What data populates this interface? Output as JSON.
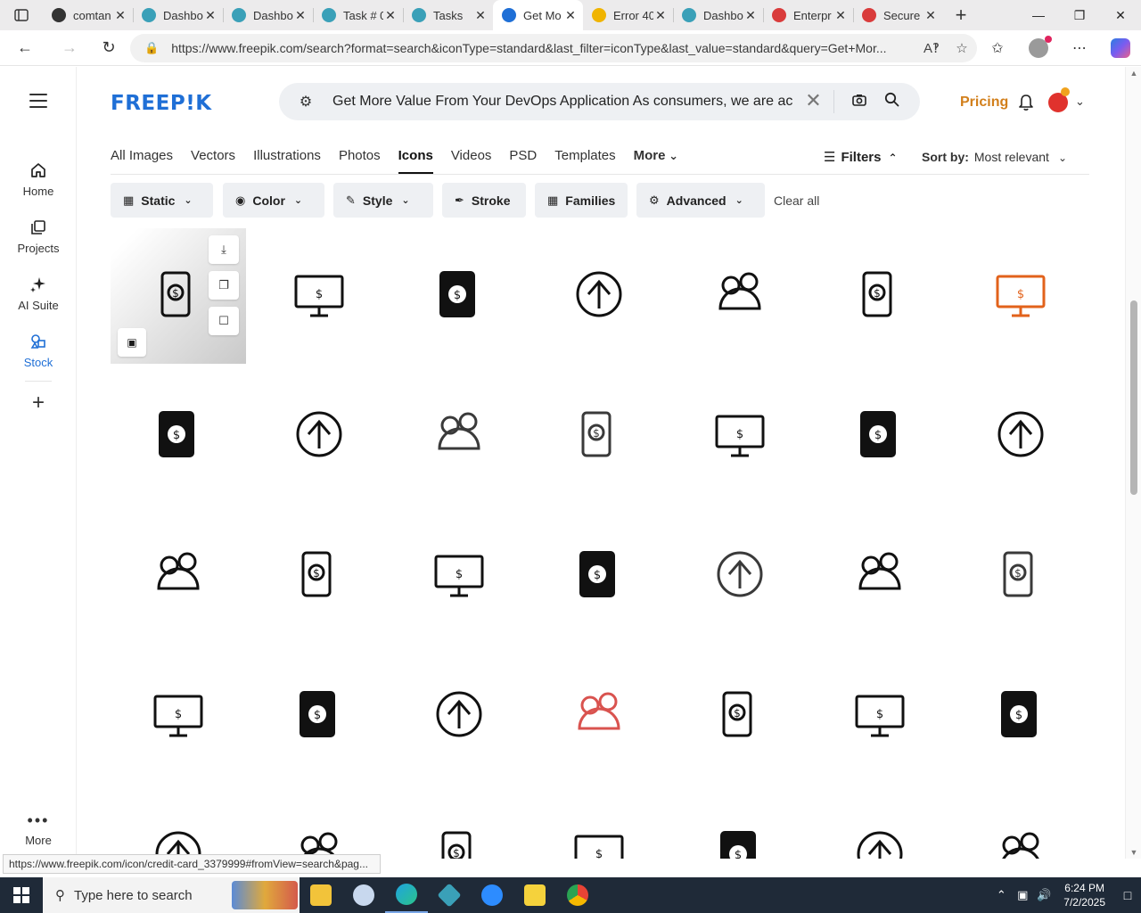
{
  "browser": {
    "tabs": [
      {
        "title": "comtan",
        "color": "#333333",
        "active": false
      },
      {
        "title": "Dashbo",
        "color": "#3aa0b8",
        "active": false
      },
      {
        "title": "Dashbo",
        "color": "#3aa0b8",
        "active": false
      },
      {
        "title": "Task # 0",
        "color": "#3aa0b8",
        "active": false
      },
      {
        "title": "Tasks",
        "color": "#3aa0b8",
        "active": false
      },
      {
        "title": "Get Mo",
        "color": "#1f6fd6",
        "active": true
      },
      {
        "title": "Error 40",
        "color": "#f0b400",
        "active": false
      },
      {
        "title": "Dashbo",
        "color": "#3aa0b8",
        "active": false
      },
      {
        "title": "Enterpr",
        "color": "#d93b3b",
        "active": false
      },
      {
        "title": "Secure",
        "color": "#d93b3b",
        "active": false
      }
    ],
    "url": "https://www.freepik.com/search?format=search&iconType=standard&last_filter=iconType&last_value=standard&query=Get+Mor..."
  },
  "sidebar": {
    "items": [
      {
        "label": "Home"
      },
      {
        "label": "Projects"
      },
      {
        "label": "AI Suite"
      },
      {
        "label": "Stock"
      }
    ],
    "more_label": "More"
  },
  "header": {
    "logo": "FREEP!K",
    "search_query": "Get More Value From Your DevOps Application As consumers, we are acc",
    "pricing": "Pricing"
  },
  "type_tabs": [
    {
      "label": "All Images"
    },
    {
      "label": "Vectors"
    },
    {
      "label": "Illustrations"
    },
    {
      "label": "Photos"
    },
    {
      "label": "Icons",
      "active": true
    },
    {
      "label": "Videos"
    },
    {
      "label": "PSD"
    },
    {
      "label": "Templates"
    },
    {
      "label": "More"
    }
  ],
  "filters_toggle": "Filters",
  "sort": {
    "label": "Sort by:",
    "value": "Most relevant"
  },
  "filter_pills": [
    {
      "label": "Static"
    },
    {
      "label": "Color"
    },
    {
      "label": "Style"
    },
    {
      "label": "Stroke"
    },
    {
      "label": "Families"
    },
    {
      "label": "Advanced"
    }
  ],
  "clear_all": "Clear all",
  "grid_icons": [
    "bag-money-icon",
    "monitor-growth-icon",
    "phone-gear-money-icon",
    "phone-exchange-icon",
    "phone-idea-money-icon",
    "phone-idea-solid-icon",
    "phone-idea-orange-icon",
    "money-chart-icon",
    "gear-phone-money-icon",
    "laptop-money-icon",
    "money-chart-outline-icon",
    "browser-money-icon",
    "phone-cloud-money-icon",
    "circle-growth-icon",
    "monitor-house-icon",
    "monitor-stars-icon",
    "phone-search-money-icon",
    "phone-hands-money-icon",
    "monitor-growth-outline-icon",
    "clipboard-cloud-icon",
    "clipboard-cloud-outline-icon",
    "phone-hands-heart-icon",
    "phone-card-growth-icon",
    "phone-like-icon",
    "monitor-stars-red-icon",
    "phone-coins-icon",
    "cloud-click-money-icon",
    "cloud-circle-icon",
    "atm-icon",
    "banknote-icon",
    "phone-chart-icon",
    "phone-gear-money-solid-icon",
    "cloud-network-icon",
    "phone-upload-icon",
    "screens-chart-icon"
  ],
  "status_url": "https://www.freepik.com/icon/credit-card_3379999#fromView=search&pag...",
  "taskbar": {
    "search_placeholder": "Type here to search",
    "time": "6:24 PM",
    "date": "7/2/2025"
  }
}
